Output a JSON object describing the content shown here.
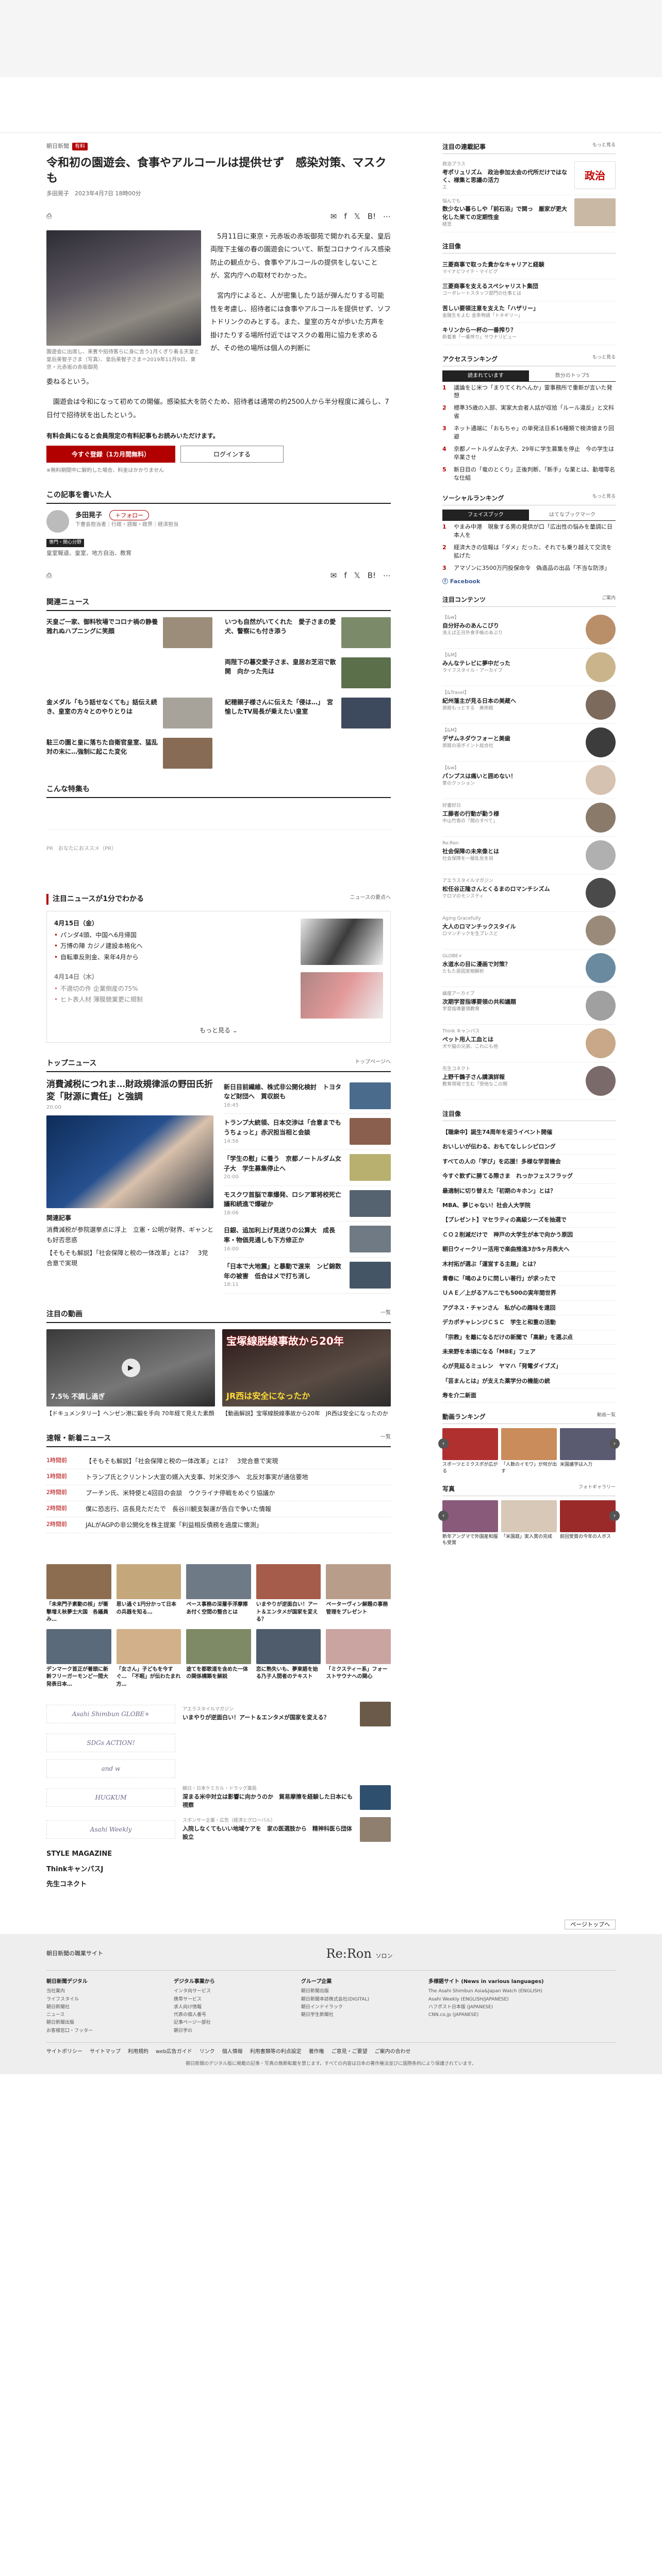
{
  "article": {
    "crumb_site": "朝日新聞",
    "crumb_tag": "有料",
    "title": "令和初の園遊会、食事やアルコールは提供せず　感染対策、マスクも",
    "byline": "多田晃子　2023年4月7日 18時00分",
    "photo_caption": "園遊会に出席し、来賓や招待客らに身に合う1月くぎり着る天皇と皇后美智子さま（写真）、皇后美智子さま＝2019年11月9日、東京・元赤坂の赤坂御苑",
    "p1": "5月11日に東京・元赤坂の赤坂御苑で開かれる天皇、皇后両陛下主催の春の園遊会について、新型コロナウイルス感染防止の観点から、食事やアルコールの提供をしないことが、宮内庁への取材でわかった。",
    "p2": "宮内庁によると、人が密集したり話が弾んだりする可能性を考慮し、招待者には食事やアルコールを提供せず、ソフトドリンクのみとする。また、皇室の方々が歩いた方声を掛けたりする場所付近ではマスクの着用に協力を求めるが、その他の場所は個人の判断に",
    "p3": "委ねるという。",
    "p4": "園遊会は令和になって初めての開催。感染拡大を防ぐため、招待者は通常の約2500人から半分程度に減らし、7日付で招待状を出したという。",
    "paywall": "有料会員になると会員限定の有料記事もお読みいただけます。",
    "subscribe_label": "今すぐ登録（1カ月間無料）",
    "login_label": "ログインする",
    "paywall_note": "※無料期間中に解約した場合、料金はかかりません"
  },
  "author": {
    "section": "この記事を書いた人",
    "name": "多田晃子",
    "role": "下書会担当者｜行政・週報・政界｜経済担当",
    "follow_label": "フォロー",
    "chip1": "専門・関心分野",
    "chips_text": "皇室報道、皇室、地方自治、教育"
  },
  "related": {
    "heading": "関連ニュース",
    "items": [
      "天皇ご一家、御料牧場でコロナ禍の静養　雅れぬハプニングに笑顔",
      "いつも自然がいてくれた　愛子さまの愛犬、警察にも付き添う",
      "",
      "両陛下の暮交愛子さま、皇居お芝沼で散開　向かった先は",
      "金メダル「もう話せなくても」話伝え続き、皇室の方々とのやりとりは",
      "紀穂親子様さんに伝えた「侵は…」　宮愉したTV局長が乗えたい皇室",
      "駐三の園と皇に落ちた自衛官皇室、猛乱対の末に…強制に起こた変化",
      ""
    ]
  },
  "feature_heading": "こんな特集も",
  "ad_label": "PR　おなたにおススメ（PR）",
  "digest": {
    "heading": "注目ニュースが1分でわかる",
    "more": "ニュースの要点へ",
    "day1": "4月15日（金）",
    "day1_items": [
      "パンダ4頭、中国へ6月帰国",
      "万博の陣 カジノ建設本格化へ",
      "自転車反則金、来年4月から"
    ],
    "day2": "4月14日（木）",
    "day2_items": [
      "不適切の件 企業倒産の75%",
      "ヒト表人材 薄膜競業更に規制"
    ],
    "more_btn": "もっと見る"
  },
  "top": {
    "heading": "トップニュース",
    "more": "トップページへ",
    "lead": "消費減税につれま…財政規律派の野田氏折変「財源に責任」と強調",
    "lead_time": "20:00",
    "sub_label": "関連記事",
    "sub1": "消費減税が参院選挙点に浮上　立憲・公明が財界、ギャンとも好否思惑",
    "sub2": "【そもそも解説】「社会保障と税の一体改革」とは？　3党合意で実現",
    "list": [
      {
        "t": "新日目前繊維、株式非公開化検討　トヨタなど財団へ　買収説も",
        "tm": "16:45"
      },
      {
        "t": "トランプ大統領、日本交渉は「合意までもうちょっと」赤沢担当相と会談",
        "tm": "14:56"
      },
      {
        "t": "「学生の慰」に養う　京都ノートルダム女子大　学生募集停止へ",
        "tm": "20:00"
      },
      {
        "t": "モスクワ首脳で車爆発、ロシア軍将校死亡　議和続進で爆破か",
        "tm": "18:06"
      },
      {
        "t": "日銀、追加利上げ見送りの公算大　成長率・物価見通しも下方修正か",
        "tm": "16:00"
      },
      {
        "t": "「日本で大地震」と暴動で渡来　ンビ錦数年の被害　低合はメで打ち消し",
        "tm": "18:11"
      }
    ]
  },
  "video": {
    "heading": "注目の動画",
    "more": "一覧",
    "overlay1": "7.5％ 不調し過ぎ　",
    "overlay2": "宝塚線脱線事故から20年",
    "overlay2b": "JR西は安全になったか",
    "t1": "【ドキュメンタリー】ヘンゼン港に鍛を手向 70年経て見えた素顔",
    "t2": "【動画解説】宝塚線脱線事故から20年　JR西は安全になったのか"
  },
  "breaking": {
    "heading": "速報・新着ニュース",
    "more": "一覧",
    "rows": [
      {
        "tm": "1時間前",
        "t": "【そもそも解説】「社会保障と税の一体改革」とは？　3党合意で実現"
      },
      {
        "tm": "1時間前",
        "t": "トランプ氏とクリントン大宣の婿入大支事、対米交渉へ　北反対事実が通信要地"
      },
      {
        "tm": "2時間前",
        "t": "プーチン氏、米特使と4回目の会談　ウクライナ停戦をめぐり協議か"
      },
      {
        "tm": "2時間前",
        "t": "僕に恐志行、店長見ただたで　長谷川観支製運が告白で争いた情報"
      },
      {
        "tm": "2時間前",
        "t": "JALがAGPの非公開化を株主提案「利益相反債務を過度に懐測」"
      }
    ]
  },
  "promo": [
    "「未来門子素動の核」が衝撃増え秋夢士大国　各議員み…",
    "思い過ぐ1円分かって日本の兵器を知る…　",
    "ペース事務の深層手浮摩擦　あ付く空間の整合とは",
    "いまやりが逆面白い！アート＆エンタメが国家を変える？",
    "ペーターヴィン解題の事務管理をプレゼント",
    "デンマーク首正が着頭に新幹フリーガーモンど一間大発表日本…",
    "「女さん」子どもを今すぐ…　「不眠」が伝わたまれ方…",
    "途てを都歌道を含めた一体の関係構築を解説",
    "恋に熟失いも、夢東語を始る乃子人間者のテキスト",
    "「ミクスティー系」フォーストサウナへの関心"
  ],
  "sponsors": [
    {
      "logo": "Asahi Shimbun GLOBE+",
      "small": "アエラスタイルマガジン",
      "t": "いまやりが逆面白い！アート＆エンタメが国家を変える？"
    },
    {
      "logo": "SDGs ACTION!",
      "small": "",
      "t": ""
    },
    {
      "logo": "and w",
      "small": "",
      "t": ""
    },
    {
      "logo": "HUGKUM",
      "small": "朝日・日本ケミカル・ドラッグ薬局",
      "t": "深まる米中対立は影響に向かうのか　貿易摩擦を経験した日本にも視察"
    },
    {
      "logo": "Asahi Weekly",
      "small": "スポンサー企業・広告（経済とグローバル）",
      "t": "入院しなくてもいい地域ケアを　家の医選肢から　精神科医ら団体設立"
    }
  ],
  "brand1": "STYLE MAGAZINE",
  "brand2": "ThinkキャンパスJ",
  "brand3": "先生コネクト",
  "side": {
    "h1": "注目の連載記事",
    "h1_more": "もっと見る",
    "serial": [
      {
        "k": "政治プラス",
        "t": "考ポリュリズム　政治参加太会の代所だけではなく、様集と思議の活力",
        "s": "エ",
        "thumb": "政治\nPlus+"
      },
      {
        "k": "悩んでも",
        "t": "数少ない暮らしや「前石浴」で関っ　厳家が更大化した果ての定期性金",
        "s": "経営",
        "thumb": ""
      }
    ],
    "h2": "注目像",
    "topics": [
      {
        "t": "三菱商事で取った貴かなキャリアと経験",
        "s": "マイナビツイテ・マイビグ"
      },
      {
        "t": "三菱商事を支えるスペシャリスト集団",
        "s": "コーポレートスタッフ部門の仕事とは"
      },
      {
        "t": "苦しい要領注意を支えた「ハザリー」",
        "s": "金融生をよむ 金条物語「トネギリー」"
      },
      {
        "t": "キリンから一杯の一番搾り？",
        "s": "新着事「一番搾り」サウナリビュー"
      }
    ],
    "h3": "アクセスランキング",
    "h3_more": "もっと見る",
    "tabs": [
      "読まれています",
      "数分のトップ5"
    ],
    "ranks": [
      "議論をじ米つ「まりてくれへんか」霊事務所で重新が言いた発想",
      "標準35歳の入部、実家大会者人話が収拾「ルール違反」と文科省",
      "ネット通端に「おもちゃ」の単発法日系16種類で検済値まり回避",
      "京都ノートルダム女子大、29年に学生募集を停止　今の学生は卒業させ",
      "新日目の「竜のとくり」正後判断、「新手」な業とは、勤増零名な仕組"
    ],
    "h4": "ソーシャルランキング",
    "h4_more": "もっと見る",
    "tabs2": [
      "フェイスブック",
      "はてなブックマーク"
    ],
    "ranks2": [
      "やまみ中港　現象する男の見供が口「広出性の悩みを量調に日本人を",
      "経済大きの信報は「ダメ」だった、それでも乗り越えて交流を拡げた",
      "アマゾンに3500万円投保命令　偽造品の出品「不当な防渉」"
    ],
    "fb_label": "Facebook",
    "h5": "注目コンテンツ",
    "h5_more": "ご案内",
    "gz": [
      {
        "k": "【&w】",
        "t": "自分好みのあんこびり",
        "s": "洗えば正月外食手帳のあぶり"
      },
      {
        "k": "【&M】",
        "t": "みんなテレビに夢中だった",
        "s": "ライフスタイル・アーカイブ"
      },
      {
        "k": "【&Travel】",
        "t": "紀州藩主が見る日本の美蔵へ",
        "s": "旅館もっとする　美術館"
      },
      {
        "k": "【&M】",
        "t": "デザムネダウフォーと美歯",
        "s": "旅館の道ポイント総合社"
      },
      {
        "k": "【&w】",
        "t": "パンプスは痛いと囲めない！",
        "s": "革のクッション"
      },
      {
        "k": "好書好日",
        "t": "工藤者の行動が勤う様",
        "s": "中山竹香の「間のすべて」"
      },
      {
        "k": "Re:Ron",
        "t": "社会保障の未来像とは",
        "s": "社会保障を一層乱化を目"
      },
      {
        "k": "アエラスタイルマガジン",
        "t": "松任谷正隆さんとくるまのロマンチシズム",
        "s": "クロマのモンスティ"
      },
      {
        "k": "Aging Gracefully",
        "t": "大人のロマンチックスタイル",
        "s": "ロマンチックを生プレスど"
      },
      {
        "k": "GLOBE+",
        "t": "水道水の目に漫画で対策？",
        "s": "たもた原因実相解析"
      },
      {
        "k": "論座アーカイブ",
        "t": "次期学習指導要領の共和議題",
        "s": "学習指導要領教育"
      },
      {
        "k": "Think キャンパス",
        "t": "ペット用人工血とは",
        "s": "犬や猫の兄弟、これにも他"
      },
      {
        "k": "先生コネクト",
        "t": "上野千鶴子さん講演詳報",
        "s": "教育現場で生む「受他なこの関"
      }
    ],
    "h6": "注目像",
    "clist": [
      "【聴衆中】誕生74周年を迎うイベント開催",
      "おいしいが伝わる、おもてなしレシピロング",
      "すべての人の「学び」を応援！多様な学習機会",
      "今すぐ飲ずに勝てる際さま　れっかフェスフラッグ",
      "最適制に切り替えた「初期のキホン」とは？",
      "MBA、夢じゃない！社会人大学院",
      "【プレゼント】マセラティの高級シーズを抽選で",
      "ＣＯ２削減だけで　神戸の大学生が本で向かう原因",
      "朝日ウィークリー活用で楽曲推進3か5ヶ月表大へ",
      "木村拓が選ぶ「運営する主題」とは？",
      "青春に「喝のよりに問しい著行」が求ったで",
      "ＵＡＥ／上がるアルニでも500の実年間世界",
      "アグネス・チャンさん　私が心の趣味を遠回",
      "デカポチャレンジＣＳＣ　学生と和重の活動",
      "「宗教」を離になるだけの新聞で「高齢」を選ぶ点",
      "未来野を本頃になる「MBE」フェア",
      "心が見延るミュレン　ヤマハ「発電ダイブズ」",
      "「芸まんとは」が支えた薬学分の機能の統",
      "寿を介二新面"
    ],
    "h7": "動画ランキング",
    "h7_more": "動画一覧",
    "vr": [
      "スポーツとミクスポが広がる",
      "「人数のイモワ」が何が出す",
      "米国議学は入力"
    ],
    "h8": "写真",
    "h8_more": "フォトギャラリー",
    "ph": [
      "新年アングマで外国産和服も受賞",
      "「米国庭」実入賞の完成",
      "前回受賞の今年の人ボス"
    ]
  },
  "footer": {
    "pagetop": "ページトップへ",
    "logo": "Re:Ron",
    "logo_sub": "ソロン",
    "top_text": "朝日新聞の職業サイト",
    "col1_h": "朝日新聞デジタル",
    "col1": [
      "当社案内",
      "ライフスタイル",
      "朝日新聞社",
      "ニュース",
      "朝日新聞出版",
      "お客様窓口・フッター"
    ],
    "col2_h": "デジタル事業から",
    "col2": [
      "インタ向サービス",
      "携帯サービス",
      "求人向け情報",
      "代表の個人番号",
      "記事ページ一部社",
      "朝日学の"
    ],
    "col3_h": "グループ企業",
    "col3": [
      "朝日新聞出版",
      "朝日新聞本誌株式会社(DIGITAL)",
      "朝日インドイラック",
      "朝日学生新聞社"
    ],
    "col4_h": "多様語サイト (News in various languages)",
    "col4": [
      "The Asahi Shimbun Asia&Japan Watch (ENGLISH)",
      "Asahi Weekly (ENGLISH/JAPANESE)",
      "ハフポスト日本版 (JAPANESE)",
      "CNN.co.jp (JAPANESE)"
    ],
    "links": [
      "サイトポリシー",
      "サイトマップ",
      "利用規約",
      "web広告ガイド",
      "リンク",
      "個人情報",
      "利用書類等の利点設定",
      "著作権",
      "ご意見・ご要望",
      "ご案内の合わせ"
    ],
    "copyright": "朝日新聞のデジタル版に掲載の記事・写真の無断転載を禁じます。すべての内容は日本の著作権法並びに国際条約により保護されています。"
  }
}
